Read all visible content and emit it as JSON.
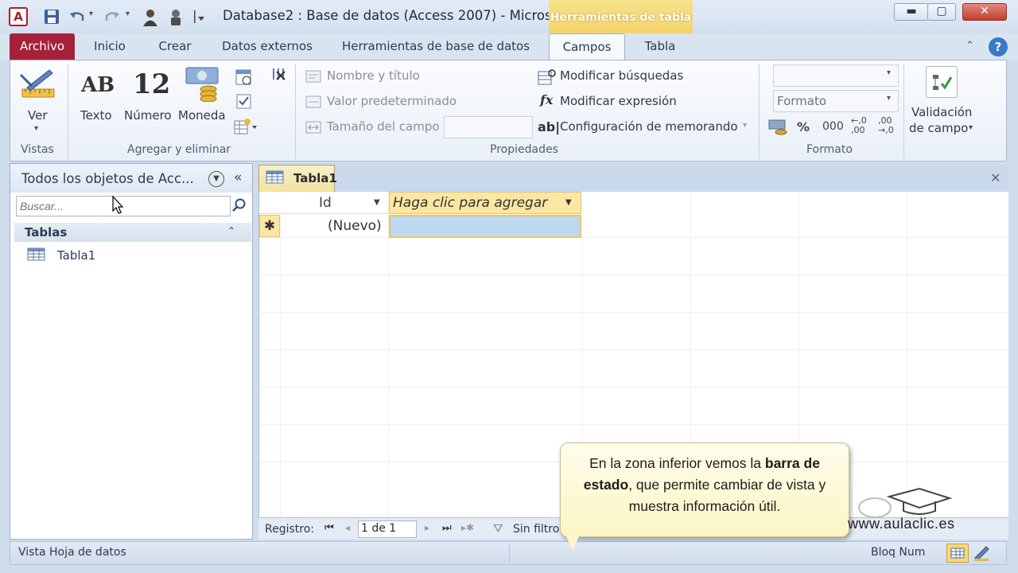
{
  "window": {
    "title": "Database2 : Base de datos (Access 2007)  -  Micros...",
    "context_tab": "Herramientas de tabla",
    "buttons": {
      "minimize": "▬",
      "maximize": "▢",
      "close": "✕"
    }
  },
  "quick_access": {
    "app_icon": "A",
    "save_icon": "save-icon",
    "undo_icon": "undo-icon",
    "redo_icon": "redo-icon"
  },
  "tabs": [
    {
      "label": "Archivo"
    },
    {
      "label": "Inicio"
    },
    {
      "label": "Crear"
    },
    {
      "label": "Datos externos"
    },
    {
      "label": "Herramientas de base de datos"
    },
    {
      "label": "Campos"
    },
    {
      "label": "Tabla"
    }
  ],
  "ribbon": {
    "groups": {
      "vistas": "Vistas",
      "agregar": "Agregar y eliminar",
      "propiedades": "Propiedades",
      "formato": "Formato"
    },
    "ver": "Ver",
    "texto_icon": "AB",
    "texto": "Texto",
    "numero_icon": "12",
    "numero": "Número",
    "moneda": "Moneda",
    "nombre_titulo": "Nombre y título",
    "valor_predeterminado": "Valor predeterminado",
    "tamano_campo": "Tamaño del campo",
    "modificar_busquedas": "Modificar búsquedas",
    "modificar_expresion": "Modificar expresión",
    "configuracion_memorando": "Configuración de memorando",
    "formato_combo": "Formato",
    "percent": "%",
    "thousands": "000",
    "dec_inc": "←,0 ,00",
    "dec_dec": ",00 →,0",
    "validacion_line1": "Validación",
    "validacion_line2": "de campo"
  },
  "nav": {
    "title": "Todos los objetos de Acc...",
    "search_placeholder": "Buscar...",
    "section": "Tablas",
    "items": [
      {
        "label": "Tabla1"
      }
    ]
  },
  "document": {
    "tab": "Tabla1",
    "columns": [
      {
        "label": "Id"
      },
      {
        "label": "Haga clic para agregar"
      }
    ],
    "new_row_marker": "✱",
    "new_row_value": "(Nuevo)"
  },
  "record_bar": {
    "label": "Registro:",
    "position": "1 de 1",
    "filter": "Sin filtro"
  },
  "status_bar": {
    "view": "Vista Hoja de datos",
    "numlock": "Bloq Num"
  },
  "callout": {
    "part1": "En la zona inferior vemos la ",
    "bold": "barra de estado",
    "part2": ", que permite cambiar de vista y muestra información útil."
  },
  "watermark": "www.aulaclic.es"
}
